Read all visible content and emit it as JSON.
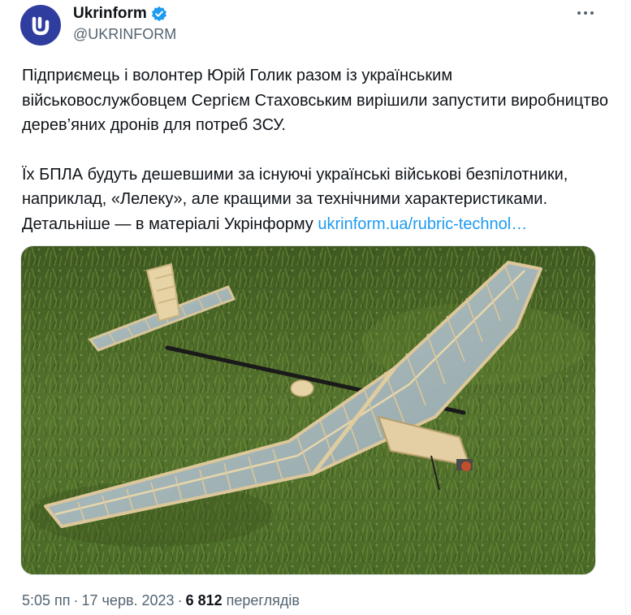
{
  "author": {
    "display_name": "Ukrinform",
    "handle": "@UKRINFORM",
    "avatar_icon": "ukrinform-logo-icon",
    "verified_icon": "verified-badge-icon",
    "avatar_color": "#2f3e9e",
    "verified_color": "#1d9bf0"
  },
  "menu": {
    "icon": "more-options-icon"
  },
  "tweet": {
    "paragraph1": "Підприємець і волонтер Юрій Голик разом із українським військовослужбовцем Сергієм Стаховським вирішили запустити виробництво дерев’яних дронів для потреб ЗСУ.",
    "paragraph2_line1": "Їх БПЛА будуть дешевшими за існуючі українські військові безпілотники, наприклад, «Лелеку», але кращими за технічними характеристиками.",
    "paragraph2_line2_prefix": "Детальніше — в матеріалі Укрінформу ",
    "link_text": "ukrinform.ua/rubric-technol…",
    "link_color": "#1d9bf0"
  },
  "media": {
    "subject": "wooden-drone-on-grass-image"
  },
  "meta": {
    "time": "5:05 пп",
    "separator": "·",
    "date": "17 черв. 2023",
    "separator2": "·",
    "views_count": "6 812",
    "views_label": "переглядів"
  }
}
